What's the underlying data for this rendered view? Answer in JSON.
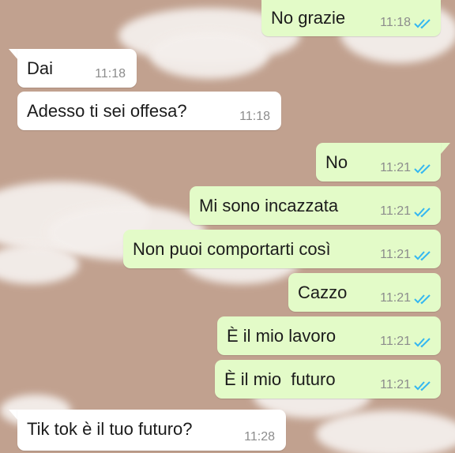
{
  "chat": {
    "background_color": "#c1a18f",
    "incoming_bubble_color": "#ffffff",
    "outgoing_bubble_color": "#e3fbc8",
    "read_tick_color": "#34b7f1",
    "messages": [
      {
        "direction": "out",
        "text": "No grazie",
        "time": "11:18",
        "status_icon": "double-check-read-icon"
      },
      {
        "direction": "in",
        "text": "Dai",
        "time": "11:18"
      },
      {
        "direction": "in",
        "text": "Adesso ti sei offesa?",
        "time": "11:18"
      },
      {
        "direction": "out",
        "text": "No",
        "time": "11:21",
        "status_icon": "double-check-read-icon"
      },
      {
        "direction": "out",
        "text": "Mi sono incazzata",
        "time": "11:21",
        "status_icon": "double-check-read-icon"
      },
      {
        "direction": "out",
        "text": "Non puoi comportarti così",
        "time": "11:21",
        "status_icon": "double-check-read-icon"
      },
      {
        "direction": "out",
        "text": "Cazzo",
        "time": "11:21",
        "status_icon": "double-check-read-icon"
      },
      {
        "direction": "out",
        "text": "È il mio lavoro",
        "time": "11:21",
        "status_icon": "double-check-read-icon"
      },
      {
        "direction": "out",
        "text": "È il mio  futuro",
        "time": "11:21",
        "status_icon": "double-check-read-icon"
      },
      {
        "direction": "in",
        "text": "Tik tok è il tuo futuro?",
        "time": "11:28"
      }
    ]
  }
}
